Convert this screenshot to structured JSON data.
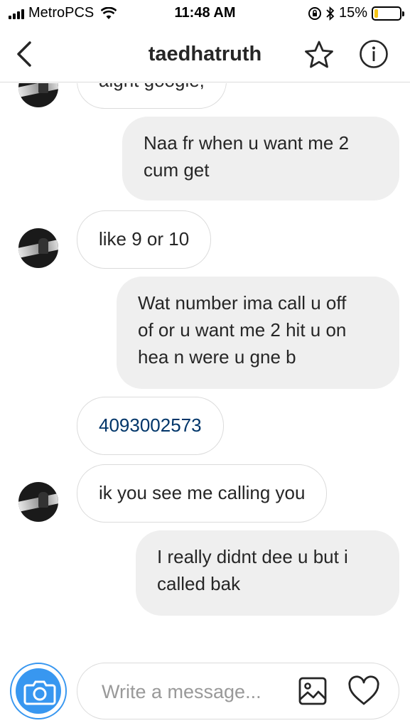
{
  "status_bar": {
    "carrier": "MetroPCS",
    "time": "11:48 AM",
    "battery": "15%",
    "battery_level": 0.15,
    "icons": [
      "signal-icon",
      "wifi-icon",
      "rotation-lock-icon",
      "bluetooth-icon",
      "battery-icon"
    ]
  },
  "header": {
    "title": "taedhatruth",
    "icons": [
      "back-chevron-icon",
      "star-icon",
      "info-icon"
    ]
  },
  "messages": [
    {
      "direction": "incoming",
      "text": "aight google,",
      "partial": true
    },
    {
      "direction": "outgoing",
      "lines": [
        "Naa fr when u want me 2",
        "cum get"
      ]
    },
    {
      "direction": "incoming",
      "text": "like 9 or 10"
    },
    {
      "direction": "outgoing",
      "lines": [
        "Wat number ima call u off",
        "of or u want me 2 hit u on",
        "hea n were u gne b"
      ]
    },
    {
      "direction": "incoming",
      "text": "4093002573",
      "link": true
    },
    {
      "direction": "incoming",
      "text": "ik you see me calling you"
    },
    {
      "direction": "outgoing",
      "lines": [
        "I really didnt dee u but i",
        "called bak"
      ]
    }
  ],
  "composer": {
    "placeholder": "Write a message...",
    "icons": [
      "camera-icon",
      "gallery-icon",
      "heart-icon"
    ]
  },
  "colors": {
    "accent": "#3897f0",
    "link": "#003569",
    "outgoing_bubble": "#efefef",
    "border": "#dbdbdb",
    "battery_fill": "#f5c518"
  }
}
